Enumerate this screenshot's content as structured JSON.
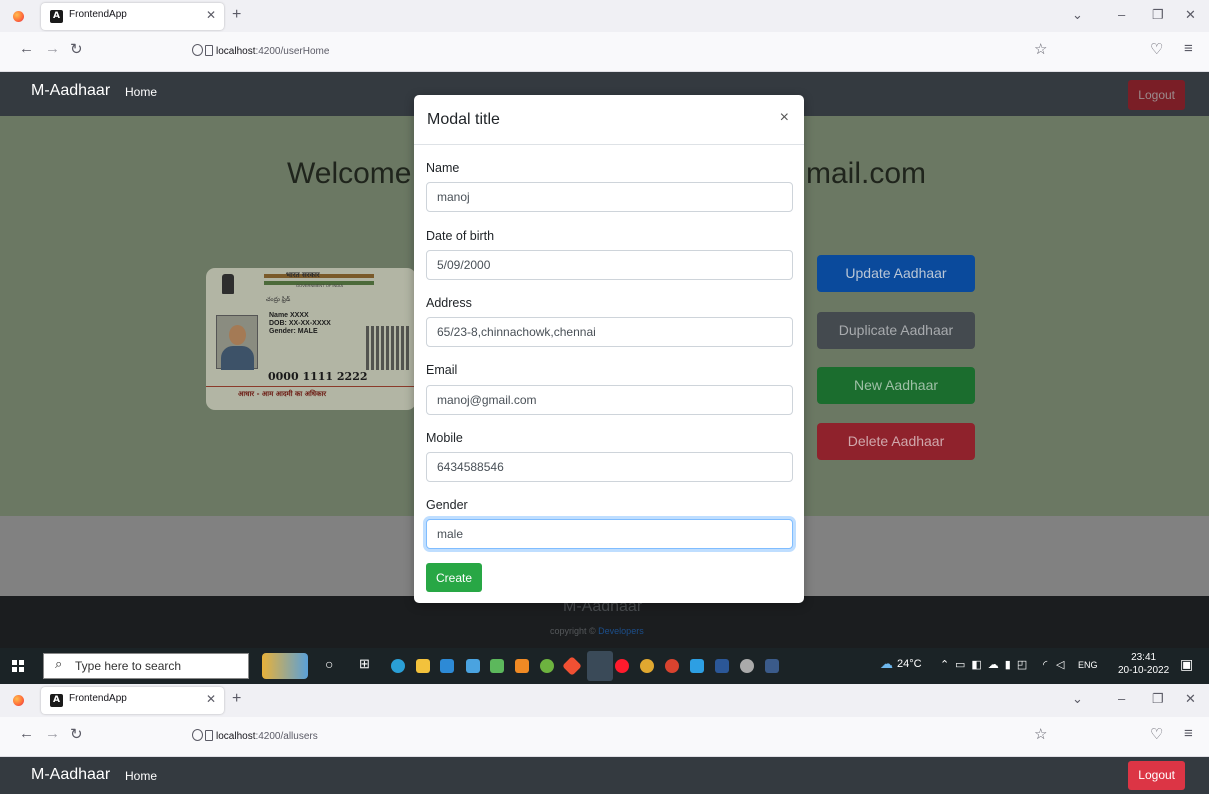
{
  "browser1": {
    "tab_title": "FrontendApp",
    "url_host": "localhost",
    "url_path": ":4200/userHome"
  },
  "app1": {
    "brand": "M-Aadhaar",
    "home": "Home",
    "logout": "Logout",
    "welcome_left": "Welcome",
    "welcome_right": "mail.com"
  },
  "aadhaar_card": {
    "header_hindi": "भारत सरकार",
    "header_english": "GOVERNMENT OF INDIA",
    "telugu": "చంద్రు ఫ్రిడ్",
    "name": "Name XXXX",
    "dob": "DOB: XX-XX-XXXX",
    "gender": "Gender: MALE",
    "number": "0000 1111 2222",
    "motto": "आधार - आम आदमी का अधिकार"
  },
  "actions": {
    "update": "Update Aadhaar",
    "duplicate": "Duplicate Aadhaar",
    "new": "New Aadhaar",
    "delete": "Delete Aadhaar"
  },
  "footer": {
    "title": "M-Aadhaar",
    "copyright": "copyright ©",
    "link": "Developers"
  },
  "modal": {
    "title": "Modal title",
    "close": "×",
    "fields": {
      "name": {
        "label": "Name",
        "value": "manoj"
      },
      "dob": {
        "label": "Date of birth",
        "value": "5/09/2000"
      },
      "address": {
        "label": "Address",
        "value": "65/23-8,chinnachowk,chennai"
      },
      "email": {
        "label": "Email",
        "value": "manoj@gmail.com"
      },
      "mobile": {
        "label": "Mobile",
        "value": "6434588546"
      },
      "gender": {
        "label": "Gender",
        "value": "male"
      }
    },
    "submit": "Create"
  },
  "taskbar": {
    "search_placeholder": "Type here to search",
    "weather": "24°C",
    "lang": "ENG",
    "time": "23:41",
    "date": "20-10-2022",
    "notifications": "1"
  },
  "browser2": {
    "tab_title": "FrontendApp",
    "url_host": "localhost",
    "url_path": ":4200/allusers"
  },
  "app2": {
    "brand": "M-Aadhaar",
    "home": "Home",
    "logout": "Logout"
  },
  "colors": {
    "navbar": "#343a40",
    "danger": "#dc3545",
    "primary": "#007bff",
    "secondary": "#6c757d",
    "success": "#28a745"
  }
}
